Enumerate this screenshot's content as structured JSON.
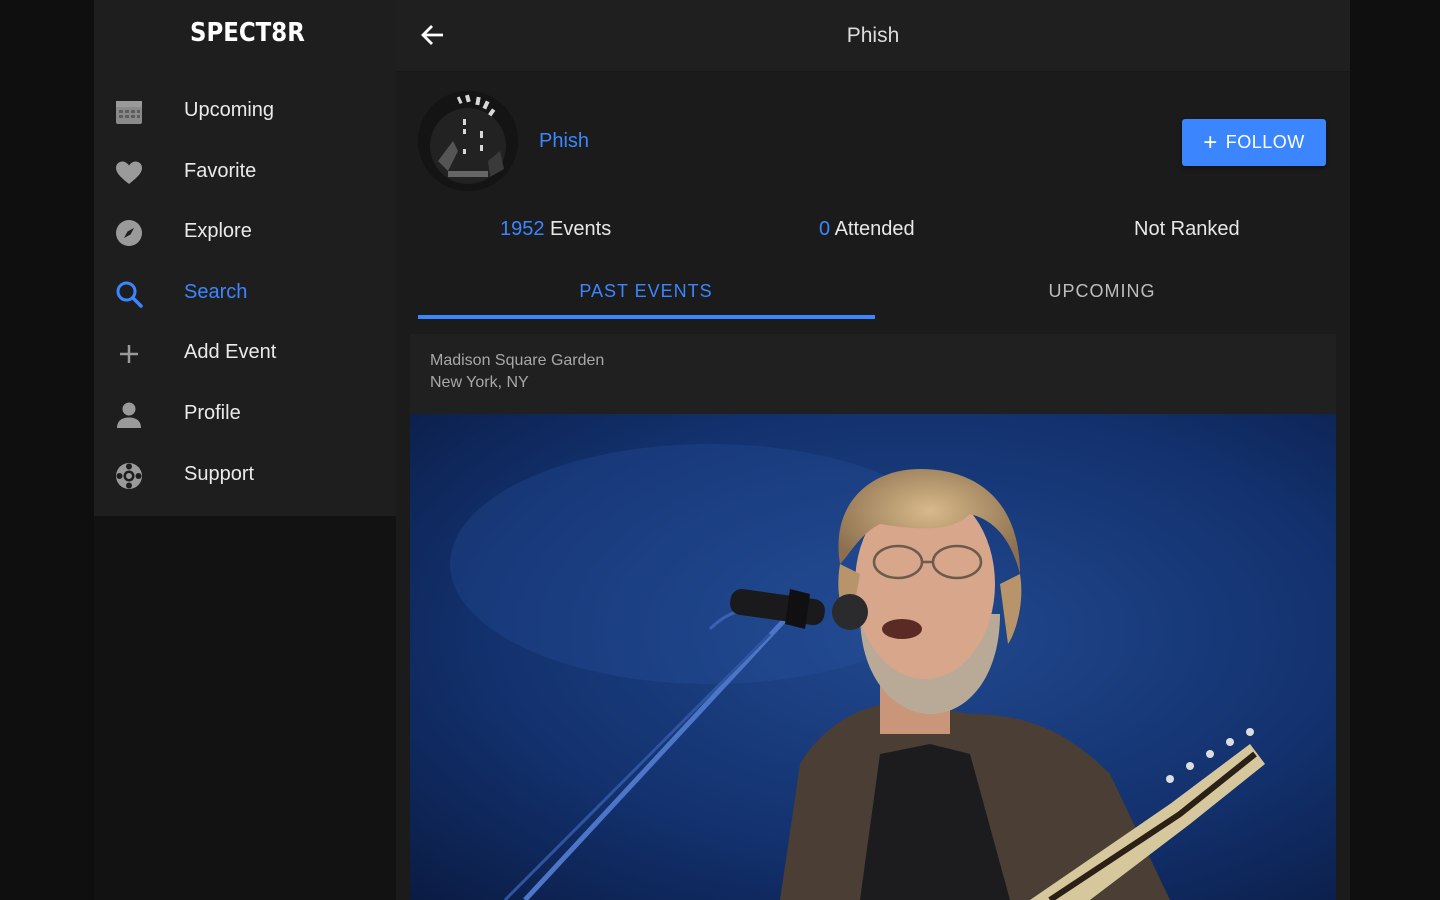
{
  "app": {
    "logo": "SPECT8R"
  },
  "sidebar": {
    "items": [
      {
        "label": "Upcoming",
        "icon": "calendar-icon"
      },
      {
        "label": "Favorite",
        "icon": "heart-icon"
      },
      {
        "label": "Explore",
        "icon": "compass-icon"
      },
      {
        "label": "Search",
        "icon": "search-icon",
        "active": true
      },
      {
        "label": "Add Event",
        "icon": "plus-icon"
      },
      {
        "label": "Profile",
        "icon": "person-icon"
      },
      {
        "label": "Support",
        "icon": "lifebuoy-icon"
      }
    ]
  },
  "header": {
    "title": "Phish",
    "back_icon": "arrow-left-icon"
  },
  "artist": {
    "name": "Phish",
    "follow_label": "FOLLOW",
    "stats": {
      "events_count": "1952",
      "events_label": " Events",
      "attended_count": "0",
      "attended_label": " Attended",
      "rank": "Not Ranked"
    }
  },
  "tabs": [
    {
      "label": "PAST EVENTS",
      "active": true
    },
    {
      "label": "UPCOMING",
      "active": false
    }
  ],
  "events": [
    {
      "venue": "Madison Square Garden",
      "city": "New York, NY"
    }
  ],
  "colors": {
    "accent": "#3b86ff",
    "background": "#1b1b1b",
    "sidebar": "#1e1e1e"
  }
}
